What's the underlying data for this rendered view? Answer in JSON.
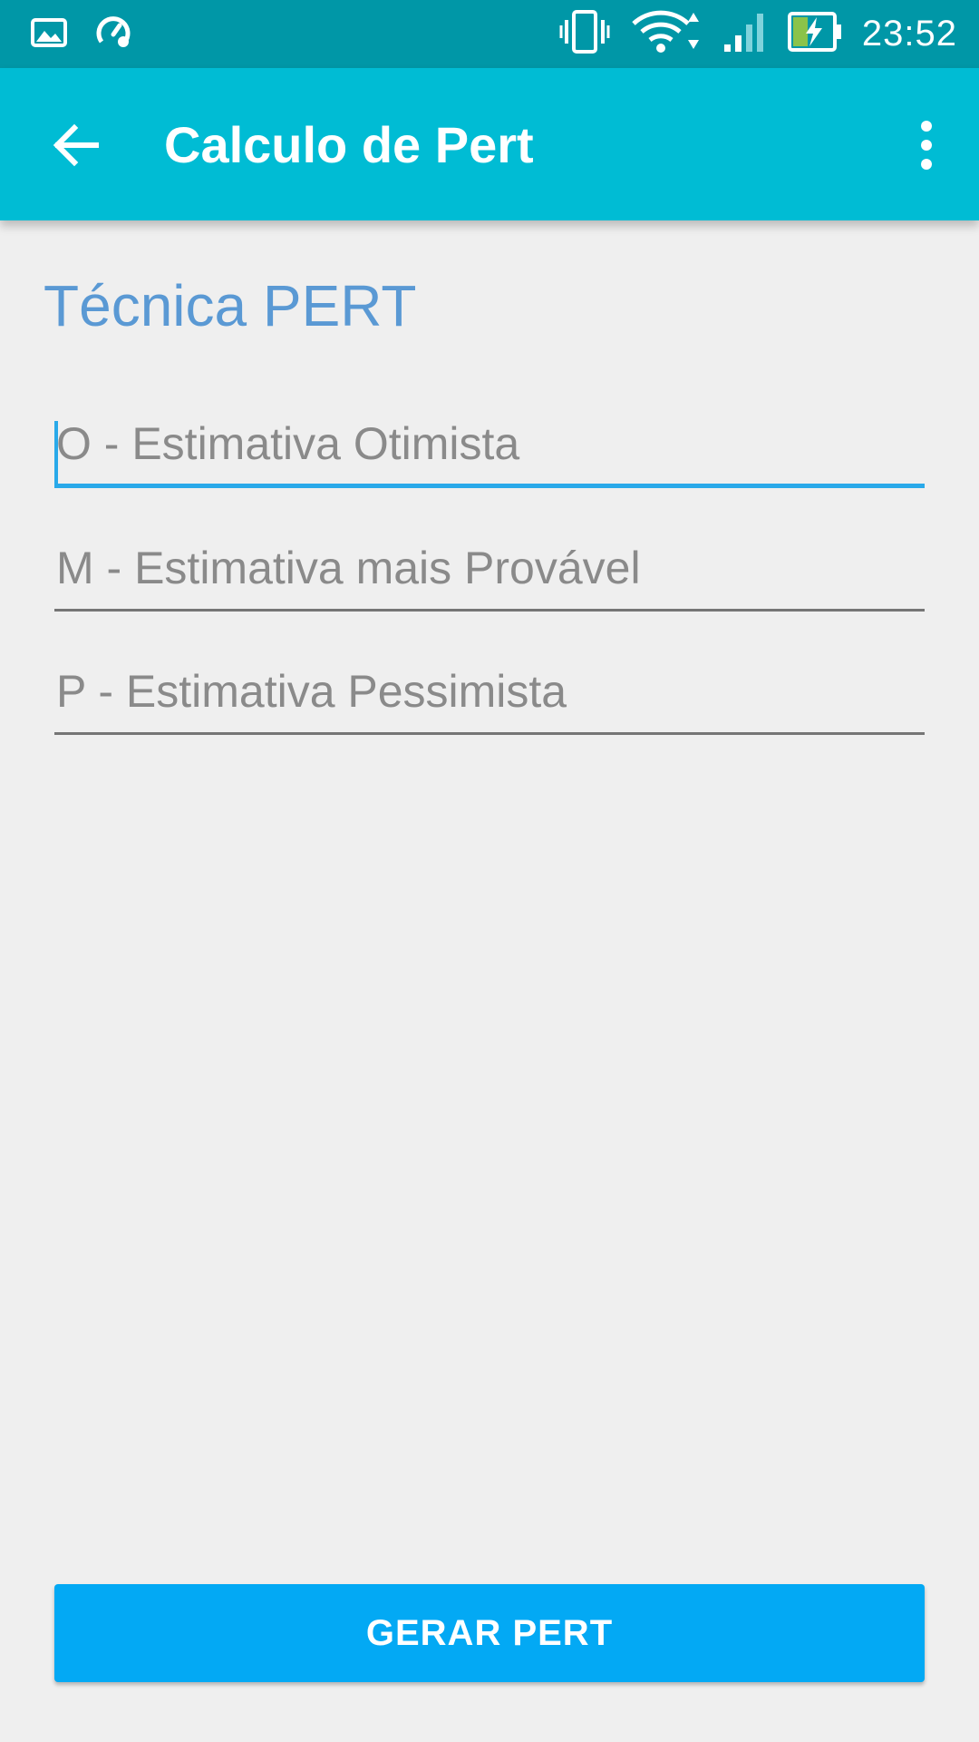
{
  "status_bar": {
    "time": "23:52",
    "icons": [
      "gallery-icon",
      "speed-settings-icon",
      "vibrate-icon",
      "wifi-icon",
      "signal-icon",
      "battery-charging-icon"
    ]
  },
  "app_bar": {
    "title": "Calculo de Pert",
    "back_icon": "arrow-back-icon",
    "menu_icon": "more-vert-icon"
  },
  "main": {
    "section_title": "Técnica PERT",
    "fields": [
      {
        "placeholder": "O - Estimativa Otimista",
        "value": ""
      },
      {
        "placeholder": "M - Estimativa mais Provável",
        "value": ""
      },
      {
        "placeholder": "P - Estimativa Pessimista",
        "value": ""
      }
    ],
    "button_label": "GERAR PERT"
  },
  "colors": {
    "status_bar": "#0097a7",
    "app_bar": "#00bcd4",
    "accent": "#29a9e9",
    "button": "#03a9f4",
    "section_title": "#5a99d4",
    "background": "#efefef"
  }
}
